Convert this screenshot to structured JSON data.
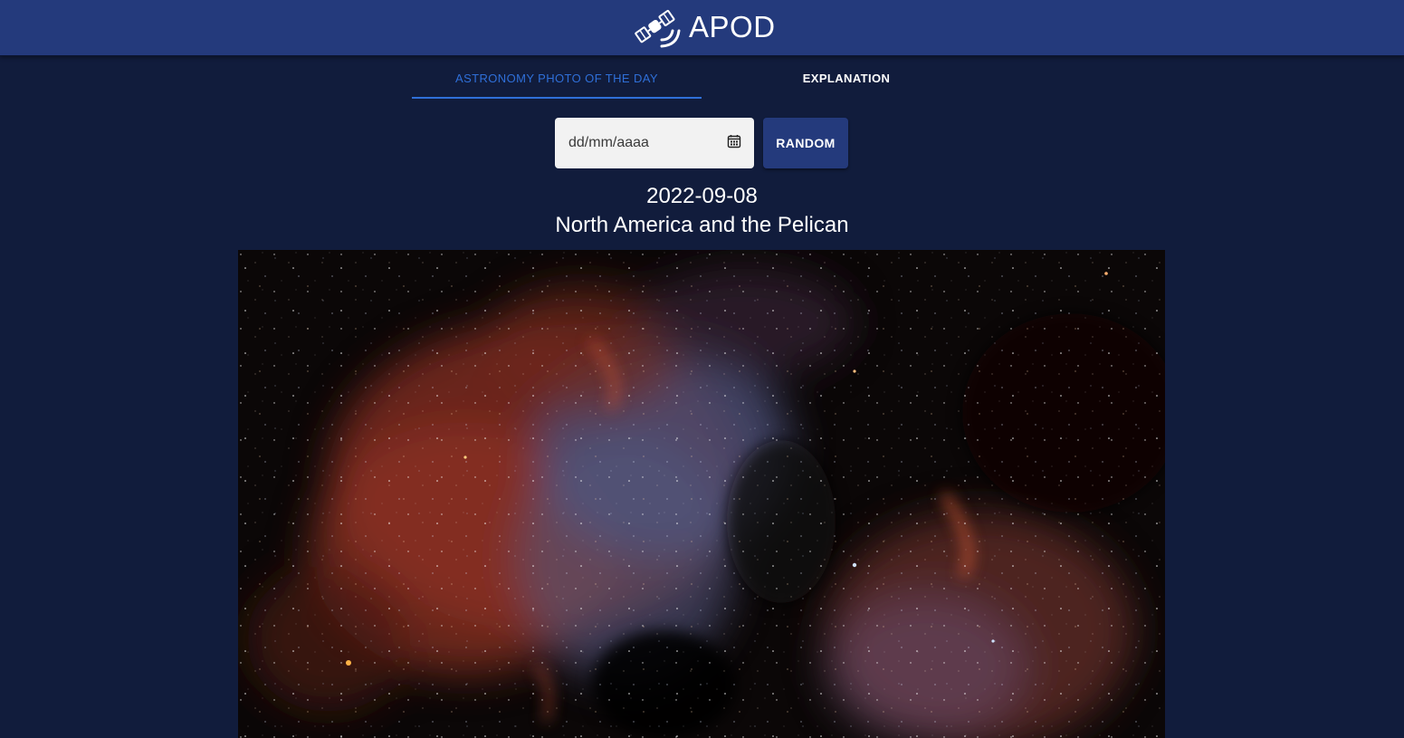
{
  "header": {
    "title": "APOD",
    "logo_icon": "satellite-icon"
  },
  "tabs": [
    {
      "label": "ASTRONOMY PHOTO OF THE DAY",
      "active": true
    },
    {
      "label": "EXPLANATION",
      "active": false
    }
  ],
  "date_picker": {
    "value": "",
    "placeholder": "dd/mm/aaaa",
    "icon": "calendar-icon"
  },
  "random_button": {
    "label": "RANDOM"
  },
  "apod": {
    "date": "2022-09-08",
    "title": "North America and the Pelican"
  },
  "colors": {
    "appbar": "#243a7c",
    "background": "#111c3c",
    "accent": "#2f6fd8"
  }
}
